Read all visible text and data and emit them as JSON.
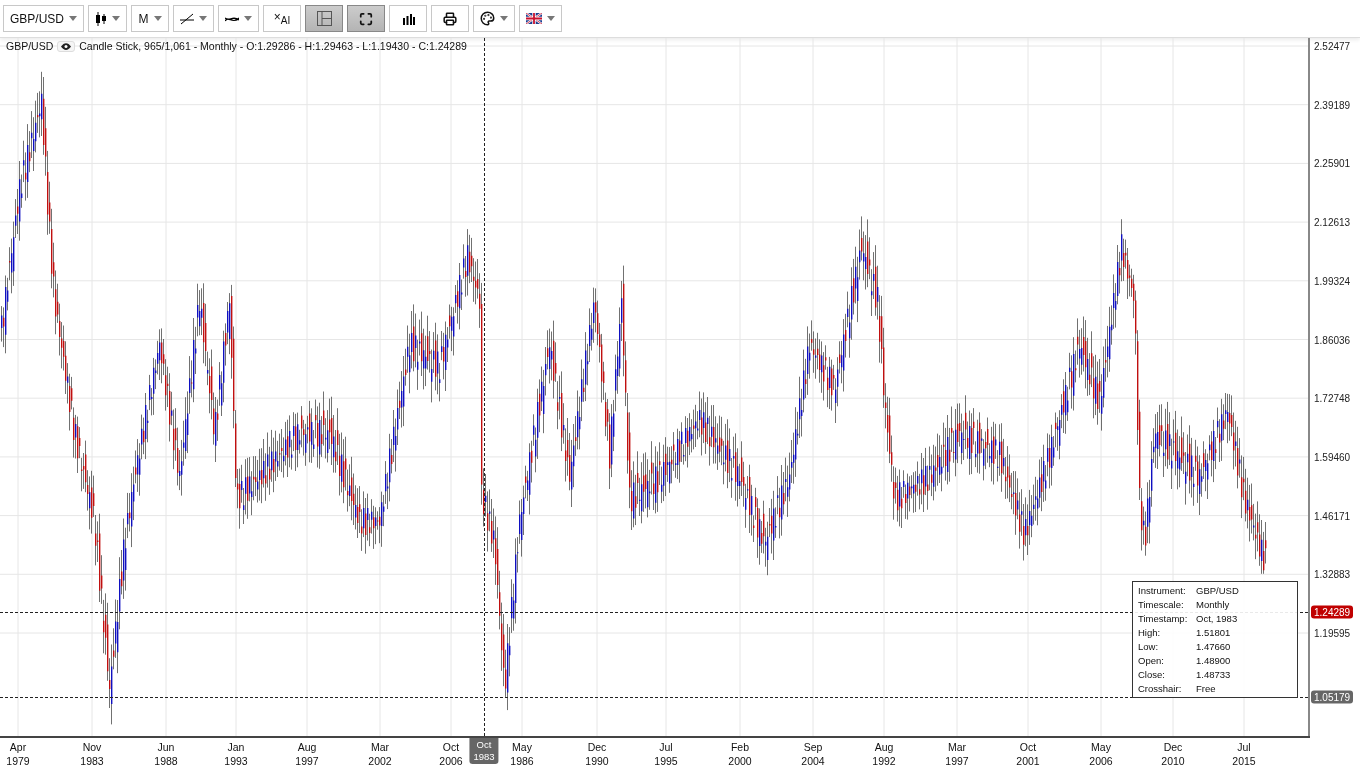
{
  "toolbar": [
    {
      "kind": "symbol",
      "label": "GBP/USD",
      "dropdown": true,
      "pressed": false
    },
    {
      "kind": "chart-type",
      "dropdown": true,
      "pressed": false
    },
    {
      "kind": "timescale",
      "label": "M",
      "dropdown": true,
      "pressed": false
    },
    {
      "kind": "drawing",
      "dropdown": true,
      "pressed": false
    },
    {
      "kind": "indicator",
      "dropdown": true,
      "pressed": false
    },
    {
      "kind": "clear",
      "label": "×$_{AI}$",
      "dropdown": false,
      "pressed": false
    },
    {
      "kind": "grid",
      "dropdown": false,
      "pressed": true
    },
    {
      "kind": "fullscreen",
      "dropdown": false,
      "pressed": true
    },
    {
      "kind": "volume",
      "dropdown": false,
      "pressed": false
    },
    {
      "kind": "print",
      "dropdown": false,
      "pressed": false
    },
    {
      "kind": "theme",
      "dropdown": true,
      "pressed": false
    },
    {
      "kind": "language",
      "dropdown": true,
      "pressed": false
    }
  ],
  "chart": {
    "symbol": "GBP/USD",
    "visible": true,
    "summary": "Candle Stick, 965/1,061 - Monthly - O:1.29286 - H:1.29463 - L:1.19430 - C:1.24289",
    "y_ticks": [
      "2.52477",
      "2.39189",
      "2.25901",
      "2.12613",
      "1.99324",
      "1.86036",
      "1.72748",
      "1.59460",
      "1.46171",
      "1.32883",
      "1.19595"
    ],
    "x_ticks": [
      {
        "month": "Apr",
        "year": "1979"
      },
      {
        "month": "Nov",
        "year": "1983"
      },
      {
        "month": "Jun",
        "year": "1988"
      },
      {
        "month": "Jan",
        "year": "1993"
      },
      {
        "month": "Aug",
        "year": "1997"
      },
      {
        "month": "Mar",
        "year": "2002"
      },
      {
        "month": "Oct",
        "year": "2006"
      },
      {
        "month": "May",
        "year": "1986"
      },
      {
        "month": "Dec",
        "year": "1990"
      },
      {
        "month": "Jul",
        "year": "1995"
      },
      {
        "month": "Feb",
        "year": "2000"
      },
      {
        "month": "Sep",
        "year": "2004"
      },
      {
        "month": "Aug",
        "year": "1992"
      },
      {
        "month": "Mar",
        "year": "1997"
      },
      {
        "month": "Oct",
        "year": "2001"
      },
      {
        "month": "May",
        "year": "2006"
      },
      {
        "month": "Dec",
        "year": "2010"
      },
      {
        "month": "Jul",
        "year": "2015"
      }
    ],
    "last_price": "1.24289",
    "crosshair_price": "1.05179",
    "crosshair_time": {
      "month": "Oct",
      "year": "1983"
    },
    "info": [
      {
        "label": "Instrument:",
        "value": "GBP/USD"
      },
      {
        "label": "Timescale:",
        "value": "Monthly"
      },
      {
        "label": "Timestamp:",
        "value": "Oct, 1983"
      },
      {
        "label": "High:",
        "value": "1.51801"
      },
      {
        "label": "Low:",
        "value": "1.47660"
      },
      {
        "label": "Open:",
        "value": "1.48900"
      },
      {
        "label": "Close:",
        "value": "1.48733"
      },
      {
        "label": "Crosshair:",
        "value": "Free"
      }
    ]
  }
}
